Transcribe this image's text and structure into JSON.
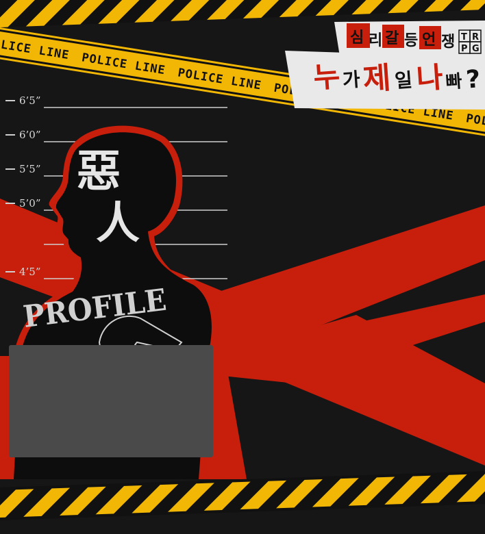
{
  "tape": {
    "label": "POLICE LINE"
  },
  "height_chart": {
    "marks": [
      "6’5”",
      "6’0”",
      "5’5”",
      "5’0”",
      "4’5”"
    ]
  },
  "figure": {
    "kanji_top": "惡",
    "kanji_bottom": "人",
    "profile_label": "PROFILE"
  },
  "logo": {
    "chars": [
      "심",
      "리",
      "갈",
      "등",
      "언",
      "쟁"
    ],
    "trpg_letters": [
      "T",
      "R",
      "P",
      "G"
    ],
    "subtitle_chars": [
      "누",
      "가",
      "제",
      "일",
      "나",
      "빠",
      "?"
    ]
  },
  "colors": {
    "background": "#161616",
    "accent_red": "#c81e0c",
    "tape_yellow": "#f2b705",
    "board_gray": "#4a4a4a"
  }
}
